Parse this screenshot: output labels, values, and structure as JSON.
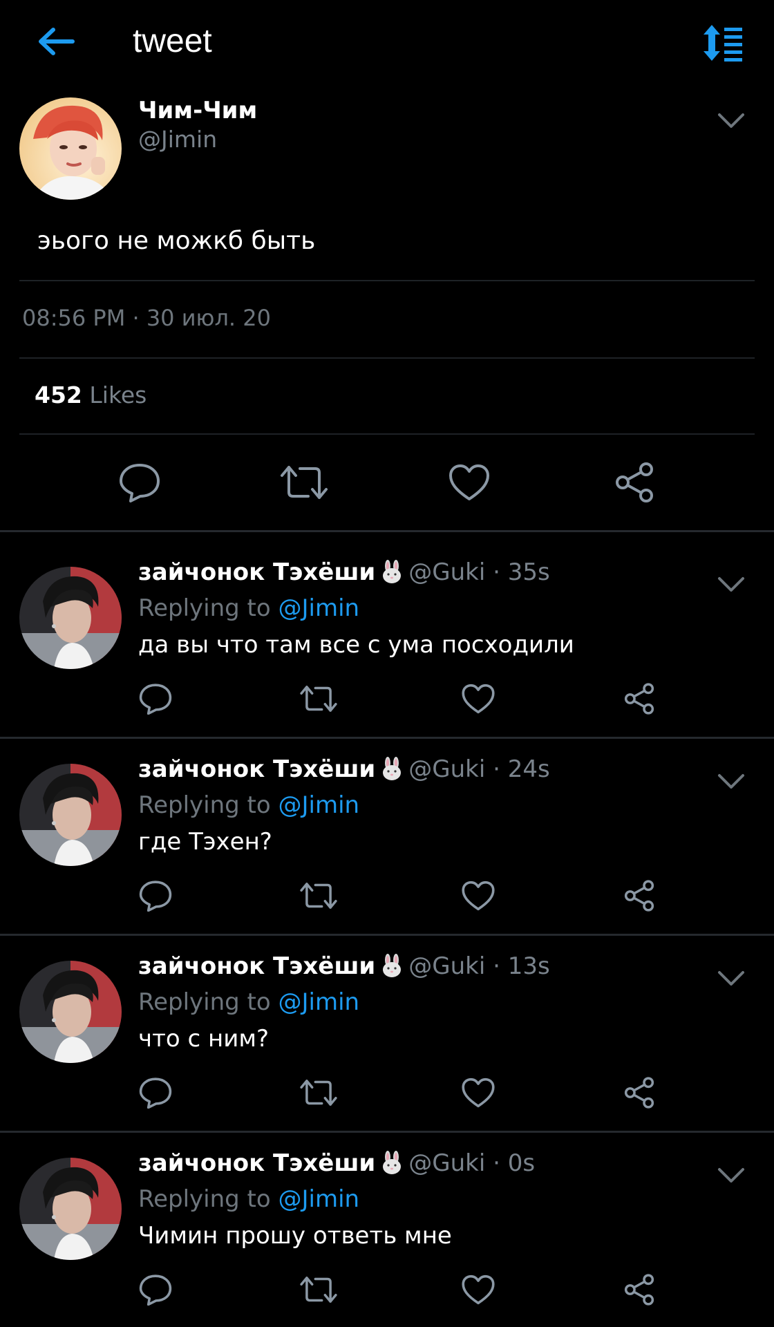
{
  "header": {
    "title": "tweet",
    "back_icon": "arrow-left-icon",
    "sort_icon": "sort-list-icon",
    "accent": "#1d9bf0"
  },
  "tweet": {
    "author_name": "Чим-Чим",
    "author_handle": "@Jimin",
    "text": "эього не можкб быть",
    "time": "08:56 PM",
    "separator": "·",
    "date": "30 июл. 20",
    "likes_count": "452",
    "likes_label": "Likes"
  },
  "replies": [
    {
      "name": "зайчонок Тэхёши",
      "emoji_icon": "rabbit-face-icon",
      "handle": "@Guki",
      "time": "· 35s",
      "replying_label": "Replying to",
      "replying_to": "@Jimin",
      "text": "да вы что там все с ума посходили"
    },
    {
      "name": "зайчонок Тэхёши",
      "emoji_icon": "rabbit-face-icon",
      "handle": "@Guki",
      "time": "· 24s",
      "replying_label": "Replying to",
      "replying_to": "@Jimin",
      "text": "где Тэхен?"
    },
    {
      "name": "зайчонок Тэхёши",
      "emoji_icon": "rabbit-face-icon",
      "handle": "@Guki",
      "time": "· 13s",
      "replying_label": "Replying to",
      "replying_to": "@Jimin",
      "text": "что с ним?"
    },
    {
      "name": "зайчонок Тэхёши",
      "emoji_icon": "rabbit-face-icon",
      "handle": "@Guki",
      "time": "· 0s",
      "replying_label": "Replying to",
      "replying_to": "@Jimin",
      "text": "Чимин прошу ответь мне"
    }
  ],
  "colors": {
    "background": "#000000",
    "text_primary": "#ffffff",
    "text_secondary": "#7a838c",
    "link": "#1d9bf0",
    "icon": "#8b98a5"
  }
}
